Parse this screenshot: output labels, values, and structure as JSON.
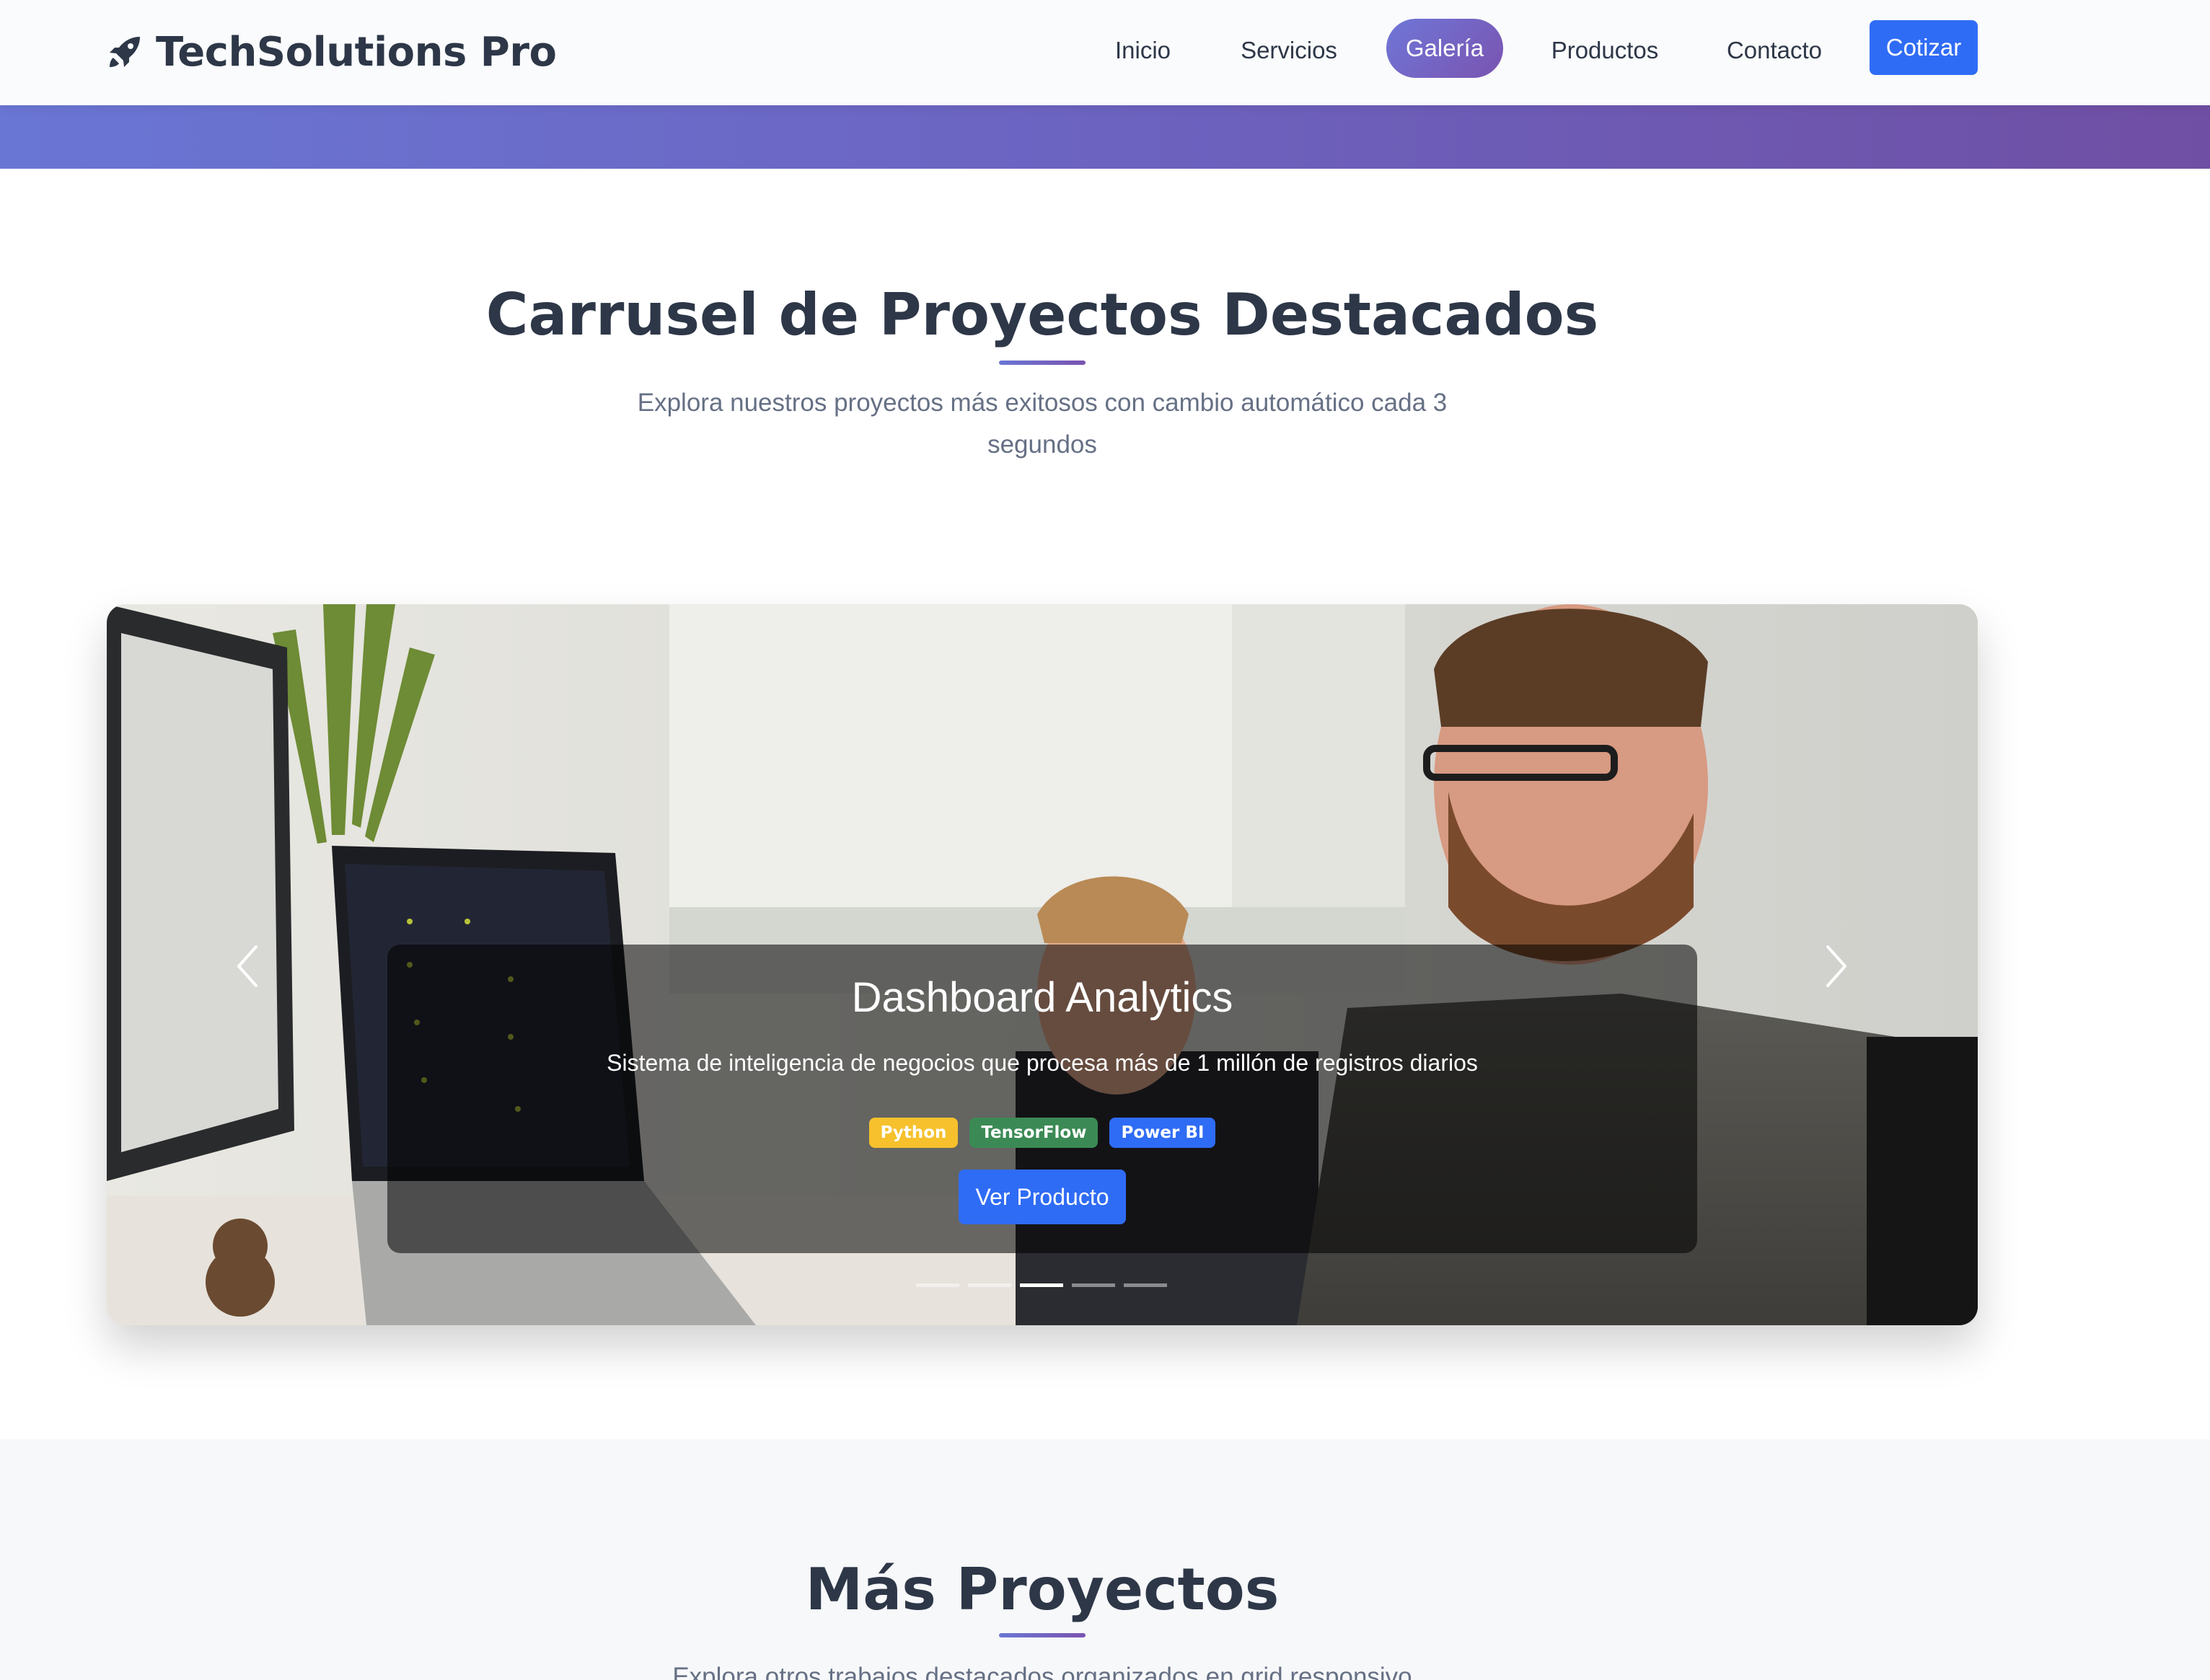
{
  "navbar": {
    "brand": "TechSolutions Pro",
    "brand_icon": "rocket-icon",
    "links": [
      {
        "label": "Inicio",
        "active": false
      },
      {
        "label": "Servicios",
        "active": false
      },
      {
        "label": "Galería",
        "active": true
      },
      {
        "label": "Productos",
        "active": false
      },
      {
        "label": "Contacto",
        "active": false
      }
    ],
    "cta": "Cotizar"
  },
  "carousel_section": {
    "title": "Carrusel de Proyectos Destacados",
    "subtitle": "Explora nuestros proyectos más exitosos con cambio automático cada 3 segundos"
  },
  "carousel": {
    "slide_title": "Dashboard Analytics",
    "slide_description": "Sistema de inteligencia de negocios que procesa más de 1 millón de registros diarios",
    "tags": [
      "Python",
      "TensorFlow",
      "Power BI"
    ],
    "button": "Ver Producto",
    "slide_count": 5,
    "active_slide": 3,
    "prev_icon": "chevron-left-icon",
    "next_icon": "chevron-right-icon"
  },
  "more_section": {
    "title": "Más Proyectos",
    "subtitle": "Explora otros trabajos destacados organizados en grid responsivo"
  },
  "colors": {
    "accent_blue": "#2f6cf5",
    "gradient_start": "#6a76d4",
    "gradient_end": "#7a53b0",
    "heading": "#2d3748",
    "muted_text": "#667085",
    "tag_python": "#f6c12c",
    "tag_tensorflow": "#3b8a55",
    "tag_powerbi": "#2f6cf5"
  }
}
